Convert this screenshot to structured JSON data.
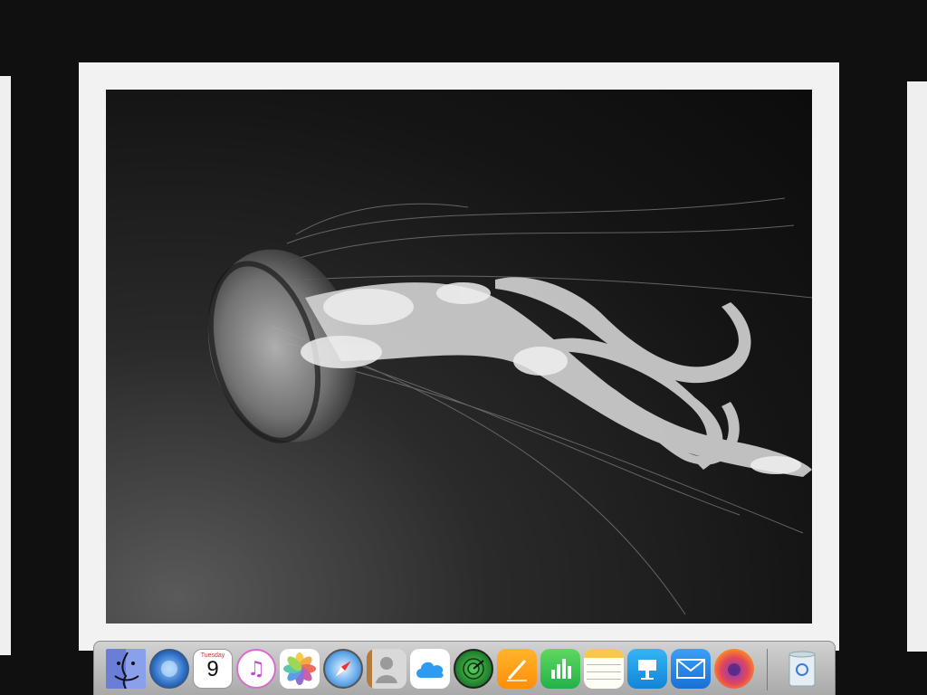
{
  "desktop": {
    "photo": {
      "subject": "jellyfish"
    }
  },
  "dock": {
    "items": [
      {
        "name": "finder-icon"
      },
      {
        "name": "launchpad-icon"
      },
      {
        "name": "calendar-icon",
        "month": "Tuesday",
        "day": "9"
      },
      {
        "name": "itunes-icon",
        "glyph": "♫"
      },
      {
        "name": "photos-icon"
      },
      {
        "name": "safari-icon"
      },
      {
        "name": "contacts-icon"
      },
      {
        "name": "icloud-icon"
      },
      {
        "name": "find-my-icon"
      },
      {
        "name": "pages-icon"
      },
      {
        "name": "numbers-icon"
      },
      {
        "name": "notes-icon"
      },
      {
        "name": "keynote-icon"
      },
      {
        "name": "mail-icon"
      },
      {
        "name": "firefox-icon"
      },
      {
        "name": "trash-icon"
      }
    ]
  },
  "colors": {
    "background": "#101010",
    "frame": "#f2f2f2",
    "dock": "#bdbdbd"
  }
}
